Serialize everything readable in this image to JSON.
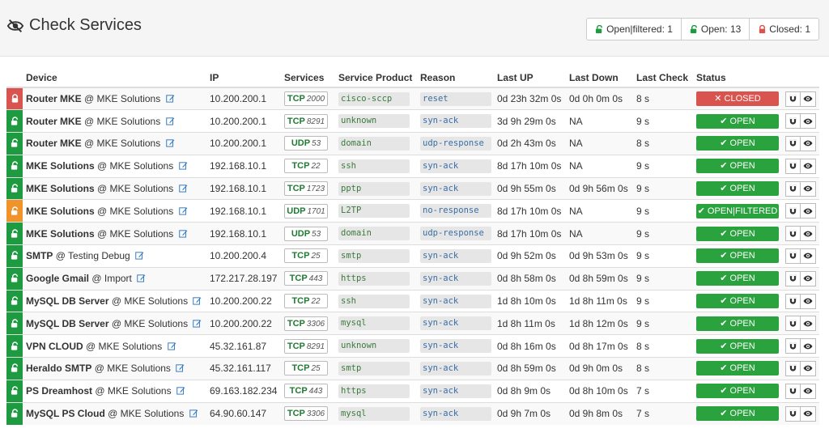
{
  "page": {
    "title": "Check Services",
    "icon": "eye-slash-icon"
  },
  "summary": [
    {
      "label": "Open|filtered: 1",
      "icon": "unlock-icon",
      "color": "#1e9a41"
    },
    {
      "label": "Open: 13",
      "icon": "unlock-icon",
      "color": "#1e9a41"
    },
    {
      "label": "Closed: 1",
      "icon": "lock-icon",
      "color": "#d9534f"
    }
  ],
  "columns": [
    "Device",
    "IP",
    "Services",
    "Service Product",
    "Reason",
    "Last UP",
    "Last Down",
    "Last Check",
    "Status"
  ],
  "colors": {
    "open": "#2aa33f",
    "closed": "#d9534f",
    "filtered": "#f0932b",
    "product": "#3c7a3c",
    "reason": "#3a6ea5"
  },
  "rows": [
    {
      "state": "closed",
      "device": "Router MKE",
      "group": "@ MKE Solutions",
      "ip": "10.200.200.1",
      "proto": "TCP",
      "port": "2000",
      "product": "cisco-sccp",
      "reason": "reset",
      "last_up": "0d 23h 32m 0s",
      "last_down": "0d 0h 0m 0s",
      "last_check": "8 s",
      "status": "✕ CLOSED"
    },
    {
      "state": "open",
      "device": "Router MKE",
      "group": "@ MKE Solutions",
      "ip": "10.200.200.1",
      "proto": "TCP",
      "port": "8291",
      "product": "unknown",
      "reason": "syn-ack",
      "last_up": "3d 9h 29m 0s",
      "last_down": "NA",
      "last_check": "9 s",
      "status": "✔ OPEN"
    },
    {
      "state": "open",
      "device": "Router MKE",
      "group": "@ MKE Solutions",
      "ip": "10.200.200.1",
      "proto": "UDP",
      "port": "53",
      "product": "domain",
      "reason": "udp-response",
      "last_up": "0d 2h 43m 0s",
      "last_down": "NA",
      "last_check": "8 s",
      "status": "✔ OPEN"
    },
    {
      "state": "open",
      "device": "MKE Solutions",
      "group": "@ MKE Solutions",
      "ip": "192.168.10.1",
      "proto": "TCP",
      "port": "22",
      "product": "ssh",
      "reason": "syn-ack",
      "last_up": "8d 17h 10m 0s",
      "last_down": "NA",
      "last_check": "9 s",
      "status": "✔ OPEN"
    },
    {
      "state": "open",
      "device": "MKE Solutions",
      "group": "@ MKE Solutions",
      "ip": "192.168.10.1",
      "proto": "TCP",
      "port": "1723",
      "product": "pptp",
      "reason": "syn-ack",
      "last_up": "0d 9h 55m 0s",
      "last_down": "0d 9h 56m 0s",
      "last_check": "9 s",
      "status": "✔ OPEN"
    },
    {
      "state": "filtered",
      "device": "MKE Solutions",
      "group": "@ MKE Solutions",
      "ip": "192.168.10.1",
      "proto": "UDP",
      "port": "1701",
      "product": "L2TP",
      "reason": "no-response",
      "last_up": "8d 17h 10m 0s",
      "last_down": "NA",
      "last_check": "9 s",
      "status": "✔ OPEN|FILTERED"
    },
    {
      "state": "open",
      "device": "MKE Solutions",
      "group": "@ MKE Solutions",
      "ip": "192.168.10.1",
      "proto": "UDP",
      "port": "53",
      "product": "domain",
      "reason": "udp-response",
      "last_up": "8d 17h 10m 0s",
      "last_down": "NA",
      "last_check": "9 s",
      "status": "✔ OPEN"
    },
    {
      "state": "open",
      "device": "SMTP",
      "group": "@ Testing Debug",
      "ip": "10.200.200.4",
      "proto": "TCP",
      "port": "25",
      "product": "smtp",
      "reason": "syn-ack",
      "last_up": "0d 9h 52m 0s",
      "last_down": "0d 9h 53m 0s",
      "last_check": "9 s",
      "status": "✔ OPEN"
    },
    {
      "state": "open",
      "device": "Google Gmail",
      "group": "@ Import",
      "ip": "172.217.28.197",
      "proto": "TCP",
      "port": "443",
      "product": "https",
      "reason": "syn-ack",
      "last_up": "0d 8h 58m 0s",
      "last_down": "0d 8h 59m 0s",
      "last_check": "9 s",
      "status": "✔ OPEN"
    },
    {
      "state": "open",
      "device": "MySQL DB Server",
      "group": "@ MKE Solutions",
      "ip": "10.200.200.22",
      "proto": "TCP",
      "port": "22",
      "product": "ssh",
      "reason": "syn-ack",
      "last_up": "1d 8h 10m 0s",
      "last_down": "1d 8h 11m 0s",
      "last_check": "9 s",
      "status": "✔ OPEN"
    },
    {
      "state": "open",
      "device": "MySQL DB Server",
      "group": "@ MKE Solutions",
      "ip": "10.200.200.22",
      "proto": "TCP",
      "port": "3306",
      "product": "mysql",
      "reason": "syn-ack",
      "last_up": "1d 8h 11m 0s",
      "last_down": "1d 8h 12m 0s",
      "last_check": "9 s",
      "status": "✔ OPEN"
    },
    {
      "state": "open",
      "device": "VPN CLOUD",
      "group": "@ MKE Solutions",
      "ip": "45.32.161.87",
      "proto": "TCP",
      "port": "8291",
      "product": "unknown",
      "reason": "syn-ack",
      "last_up": "0d 8h 16m 0s",
      "last_down": "0d 8h 17m 0s",
      "last_check": "8 s",
      "status": "✔ OPEN"
    },
    {
      "state": "open",
      "device": "Heraldo SMTP",
      "group": "@ MKE Solutions",
      "ip": "45.32.161.117",
      "proto": "TCP",
      "port": "25",
      "product": "smtp",
      "reason": "syn-ack",
      "last_up": "0d 8h 59m 0s",
      "last_down": "0d 9h 0m 0s",
      "last_check": "8 s",
      "status": "✔ OPEN"
    },
    {
      "state": "open",
      "device": "PS Dreamhost",
      "group": "@ MKE Solutions",
      "ip": "69.163.182.234",
      "proto": "TCP",
      "port": "443",
      "product": "https",
      "reason": "syn-ack",
      "last_up": "0d 8h 9m 0s",
      "last_down": "0d 8h 10m 0s",
      "last_check": "7 s",
      "status": "✔ OPEN"
    },
    {
      "state": "open",
      "device": "MySQL PS Cloud",
      "group": "@ MKE Solutions",
      "ip": "64.90.60.147",
      "proto": "TCP",
      "port": "3306",
      "product": "mysql",
      "reason": "syn-ack",
      "last_up": "0d 9h 7m 0s",
      "last_down": "0d 9h 8m 0s",
      "last_check": "7 s",
      "status": "✔ OPEN"
    }
  ]
}
